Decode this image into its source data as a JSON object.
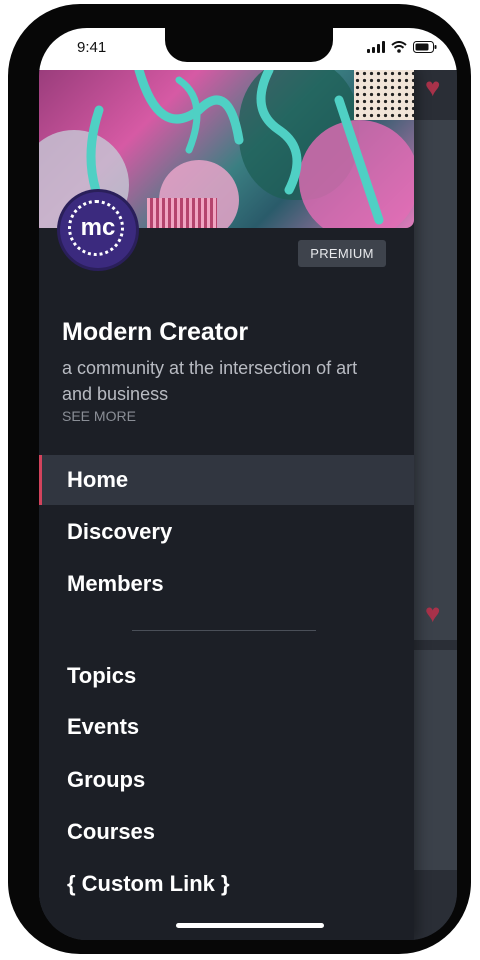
{
  "status_bar": {
    "time": "9:41",
    "icons": [
      "signal-icon",
      "wifi-icon",
      "battery-icon"
    ]
  },
  "community": {
    "logo_text": "mc",
    "badge": "PREMIUM",
    "name": "Modern Creator",
    "description": "a community at the intersection of art and business",
    "see_more": "SEE MORE"
  },
  "nav": {
    "primary": [
      {
        "label": "Home",
        "active": true
      },
      {
        "label": "Discovery",
        "active": false
      },
      {
        "label": "Members",
        "active": false
      }
    ],
    "secondary": [
      {
        "label": "Topics"
      },
      {
        "label": "Events"
      },
      {
        "label": "Groups"
      },
      {
        "label": "Courses"
      },
      {
        "label": "{ Custom Link }"
      }
    ]
  },
  "colors": {
    "drawer_bg": "#1c1f26",
    "active_bg": "#313640",
    "active_accent": "#d2435c",
    "logo_bg": "#3b2a7e",
    "badge_bg": "#3e434c"
  }
}
